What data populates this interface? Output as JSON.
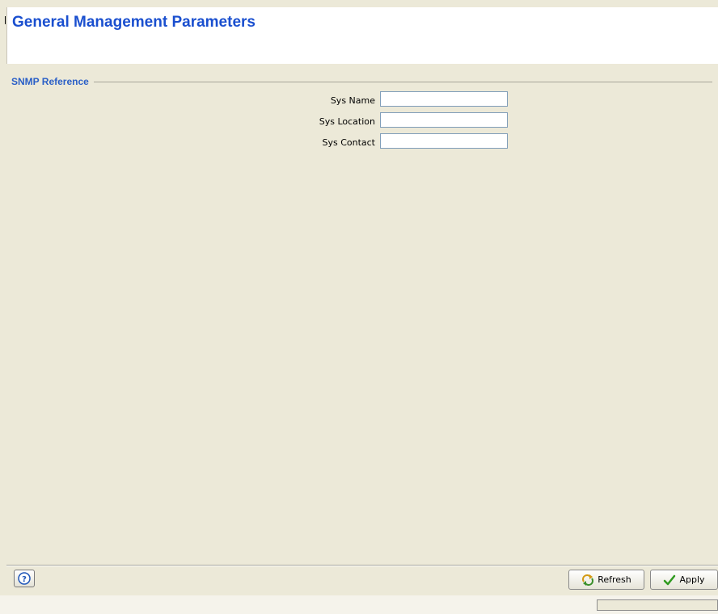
{
  "header": {
    "title": "General Management Parameters"
  },
  "section": {
    "legend": "SNMP Reference"
  },
  "fields": [
    {
      "label": "Sys Name",
      "value": "",
      "placeholder": ""
    },
    {
      "label": "Sys Location",
      "value": "",
      "placeholder": ""
    },
    {
      "label": "Sys Contact",
      "value": "",
      "placeholder": ""
    }
  ],
  "footer": {
    "help_icon": "help-icon",
    "refresh_label": "Refresh",
    "refresh_icon": "refresh-icon",
    "apply_label": "Apply",
    "apply_icon": "checkmark-icon"
  },
  "colors": {
    "title": "#1a4fcf",
    "legend": "#2a5fc7",
    "panel_bg": "#ece9d8",
    "header_bg": "#ffffff"
  }
}
